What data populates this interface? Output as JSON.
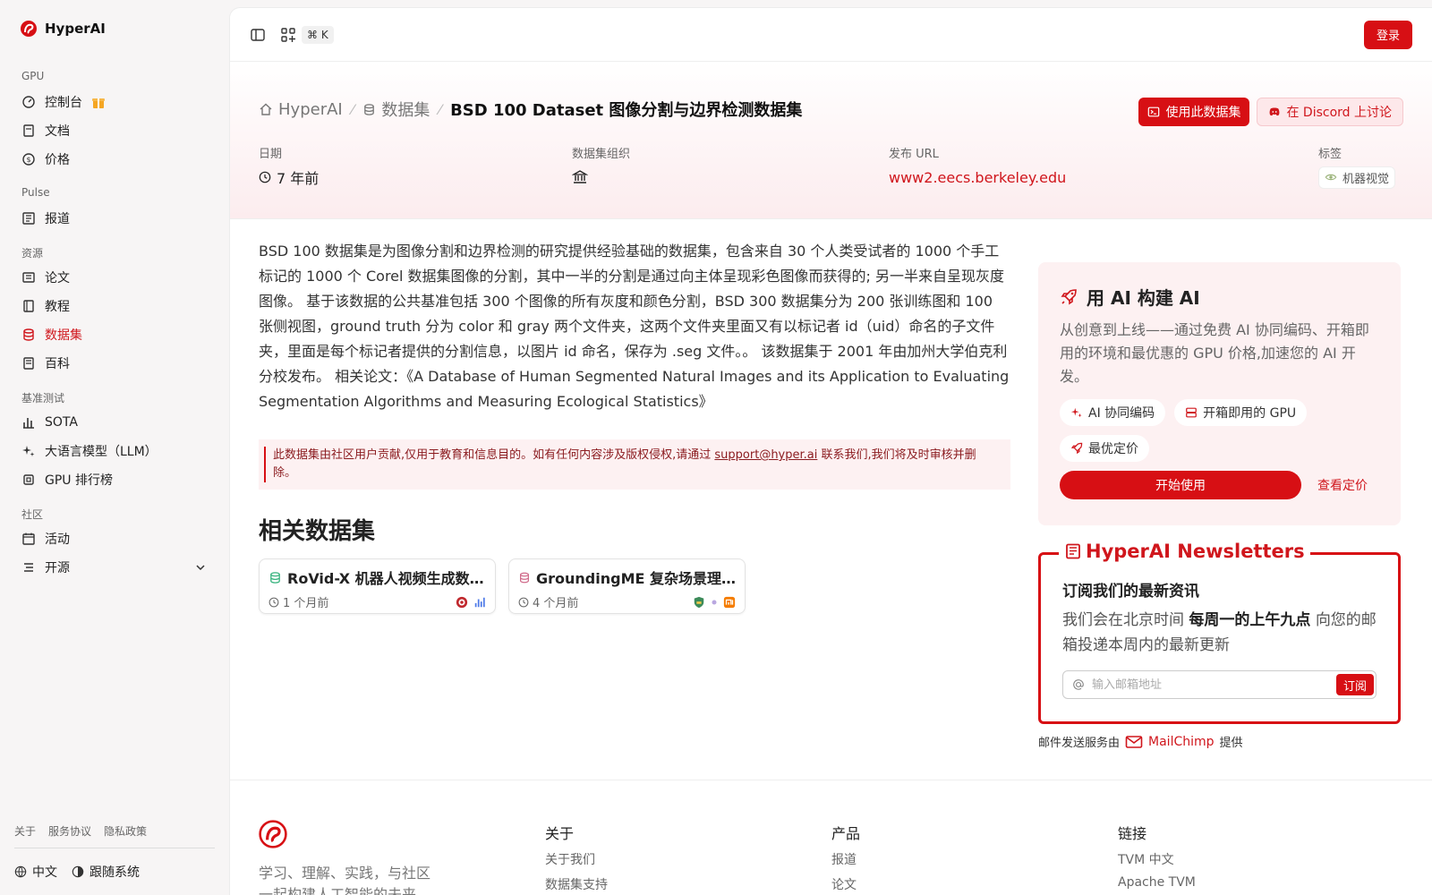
{
  "app": {
    "name": "HyperAI"
  },
  "sidebar": {
    "sections": [
      {
        "title": "GPU",
        "items": [
          {
            "label": "控制台"
          },
          {
            "label": "文档"
          },
          {
            "label": "价格"
          }
        ]
      },
      {
        "title": "Pulse",
        "items": [
          {
            "label": "报道"
          }
        ]
      },
      {
        "title": "资源",
        "items": [
          {
            "label": "论文"
          },
          {
            "label": "教程"
          },
          {
            "label": "数据集"
          },
          {
            "label": "百科"
          }
        ]
      },
      {
        "title": "基准测试",
        "items": [
          {
            "label": "SOTA"
          },
          {
            "label": "大语言模型（LLM）"
          },
          {
            "label": "GPU 排行榜"
          }
        ]
      },
      {
        "title": "社区",
        "items": [
          {
            "label": "活动"
          },
          {
            "label": "开源"
          }
        ]
      }
    ],
    "footer_links": [
      "关于",
      "服务协议",
      "隐私政策"
    ],
    "language": "中文",
    "theme": "跟随系统"
  },
  "topbar": {
    "shortcut": "⌘ K",
    "login": "登录"
  },
  "breadcrumb": {
    "home": "HyperAI",
    "section": "数据集",
    "current": "BSD 100 Dataset 图像分割与边界检测数据集"
  },
  "actions": {
    "use": "使用此数据集",
    "discuss": "在 Discord 上讨论"
  },
  "meta": {
    "date_label": "日期",
    "date_value": "7 年前",
    "org_label": "数据集组织",
    "url_label": "发布 URL",
    "url_value": "www2.eecs.berkeley.edu",
    "tags_label": "标签",
    "tag": "机器视觉"
  },
  "description": "BSD 100 数据集是为图像分割和边界检测的研究提供经验基础的数据集，包含来自 30 个人类受试者的 1000 个手工标记的 1000 个 Corel 数据集图像的分割，其中一半的分割是通过向主体呈现彩色图像而获得的; 另一半来自呈现灰度图像。 基于该数据的公共基准包括 300 个图像的所有灰度和颜色分割，BSD 300 数据集分为 200 张训练图和 100 张侧视图，ground truth 分为 color 和 gray 两个文件夹，这两个文件夹里面又有以标记者 id（uid）命名的子文件夹，里面是每个标记者提供的分割信息，以图片 id 命名，保存为 .seg 文件。。 该数据集于 2001 年由加州大学伯克利分校发布。 相关论文：《A Database of Human Segmented Natural Images and its Application to Evaluating Segmentation Algorithms and Measuring Ecological Statistics》",
  "notice": {
    "text": "此数据集由社区用户贡献,仅用于教育和信息目的。如有任何内容涉及版权侵权,请通过",
    "email": "support@hyper.ai",
    "tail": "联系我们,我们将及时审核并删除。"
  },
  "related": {
    "title": "相关数据集",
    "items": [
      {
        "name": "RoVid-X 机器人视频生成数…",
        "time": "1 个月前"
      },
      {
        "name": "GroundingME 复杂场景理…",
        "time": "4 个月前"
      }
    ]
  },
  "promo": {
    "title": "用 AI 构建 AI",
    "text": "从创意到上线——通过免费 AI 协同编码、开箱即用的环境和最优惠的 GPU 价格,加速您的 AI 开发。",
    "chips": [
      "AI 协同编码",
      "开箱即用的 GPU",
      "最优定价"
    ],
    "start": "开始使用",
    "pricing": "查看定价"
  },
  "newsletter": {
    "legend": "HyperAI Newsletters",
    "title": "订阅我们的最新资讯",
    "text_pre": "我们会在北京时间",
    "text_bold": "每周一的上午九点",
    "text_post": "向您的邮箱投递本周内的最新更新",
    "placeholder": "输入邮箱地址",
    "button": "订阅",
    "provider_pre": "邮件发送服务由",
    "provider": "MailChimp",
    "provider_post": "提供"
  },
  "footer": {
    "slogan": "学习、理解、实践，与社区一起构建人工智能的未来",
    "cols": [
      {
        "title": "关于",
        "links": [
          "关于我们",
          "数据集支持"
        ]
      },
      {
        "title": "产品",
        "links": [
          "报道",
          "论文"
        ]
      },
      {
        "title": "链接",
        "links": [
          "TVM 中文",
          "Apache TVM"
        ]
      }
    ]
  },
  "colors": {
    "accent": "#d70f14",
    "accent_soft": "#fdf1f2"
  }
}
